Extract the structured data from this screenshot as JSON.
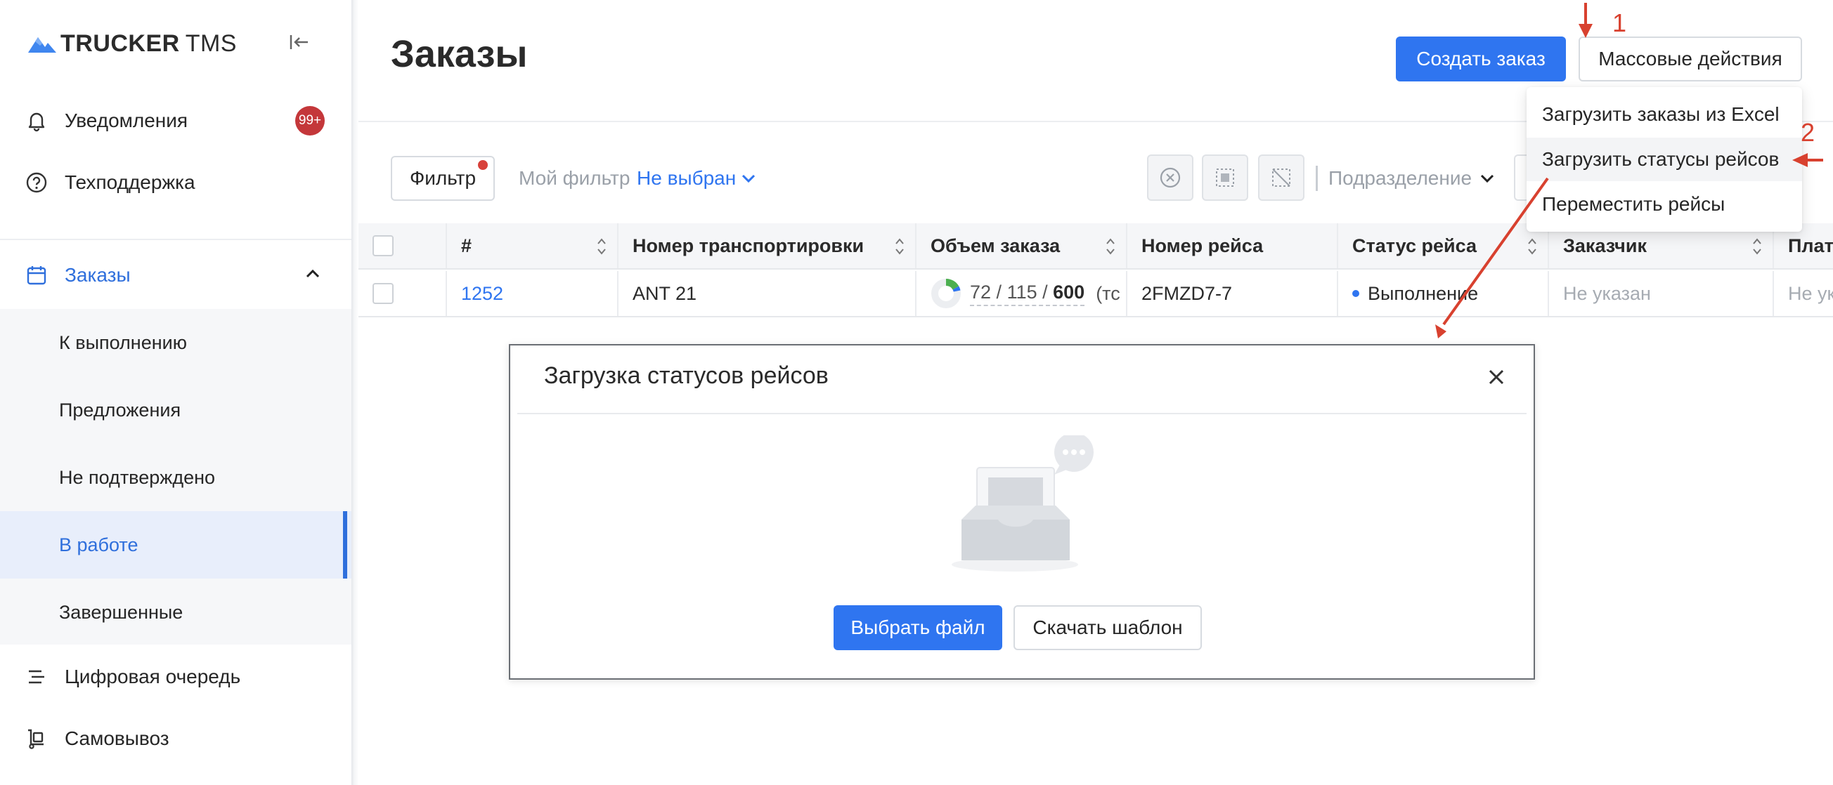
{
  "app": {
    "logo_bold": "TRUCKER",
    "logo_light": "TMS"
  },
  "sidebar": {
    "notifications": {
      "label": "Уведомления",
      "badge": "99+"
    },
    "support": {
      "label": "Техподдержка"
    },
    "orders": {
      "label": "Заказы"
    },
    "sub_items": [
      {
        "label": "К выполнению"
      },
      {
        "label": "Предложения"
      },
      {
        "label": "Не подтверждено"
      },
      {
        "label": "В работе"
      },
      {
        "label": "Завершенные"
      }
    ],
    "digital_queue": {
      "label": "Цифровая очередь"
    },
    "pickup": {
      "label": "Самовывоз"
    }
  },
  "header": {
    "title": "Заказы",
    "create_label": "Создать заказ",
    "bulk_label": "Массовые действия"
  },
  "filters": {
    "filter_label": "Фильтр",
    "my_filter_label": "Мой фильтр",
    "my_filter_value": "Не выбран",
    "subdivision_label": "Подразделение"
  },
  "dropdown": {
    "items": [
      {
        "label": "Загрузить заказы из Excel"
      },
      {
        "label": "Загрузить статусы рейсов"
      },
      {
        "label": "Переместить рейсы"
      }
    ]
  },
  "table": {
    "columns": [
      "#",
      "Номер транспортировки",
      "Объем заказа",
      "Номер рейса",
      "Статус рейса",
      "Заказчик",
      "Плате"
    ],
    "rows": [
      {
        "id": "1252",
        "transport_no": "ANT 21",
        "volume_a": "72",
        "volume_b": "115",
        "volume_c": "600",
        "volume_unit": "(тс",
        "trip_no": "2FMZD7-7",
        "status": "Выполнение",
        "customer": "Не указан",
        "payer": "Не ук"
      }
    ]
  },
  "modal": {
    "title": "Загрузка статусов рейсов",
    "choose_file_label": "Выбрать файл",
    "download_template_label": "Скачать шаблон"
  },
  "annotations": {
    "step1": "1",
    "step2": "2"
  },
  "colors": {
    "accent": "#2f75f0",
    "badge": "#c4373a",
    "annotation": "#d8412f",
    "active_bg": "#e8eefb"
  }
}
